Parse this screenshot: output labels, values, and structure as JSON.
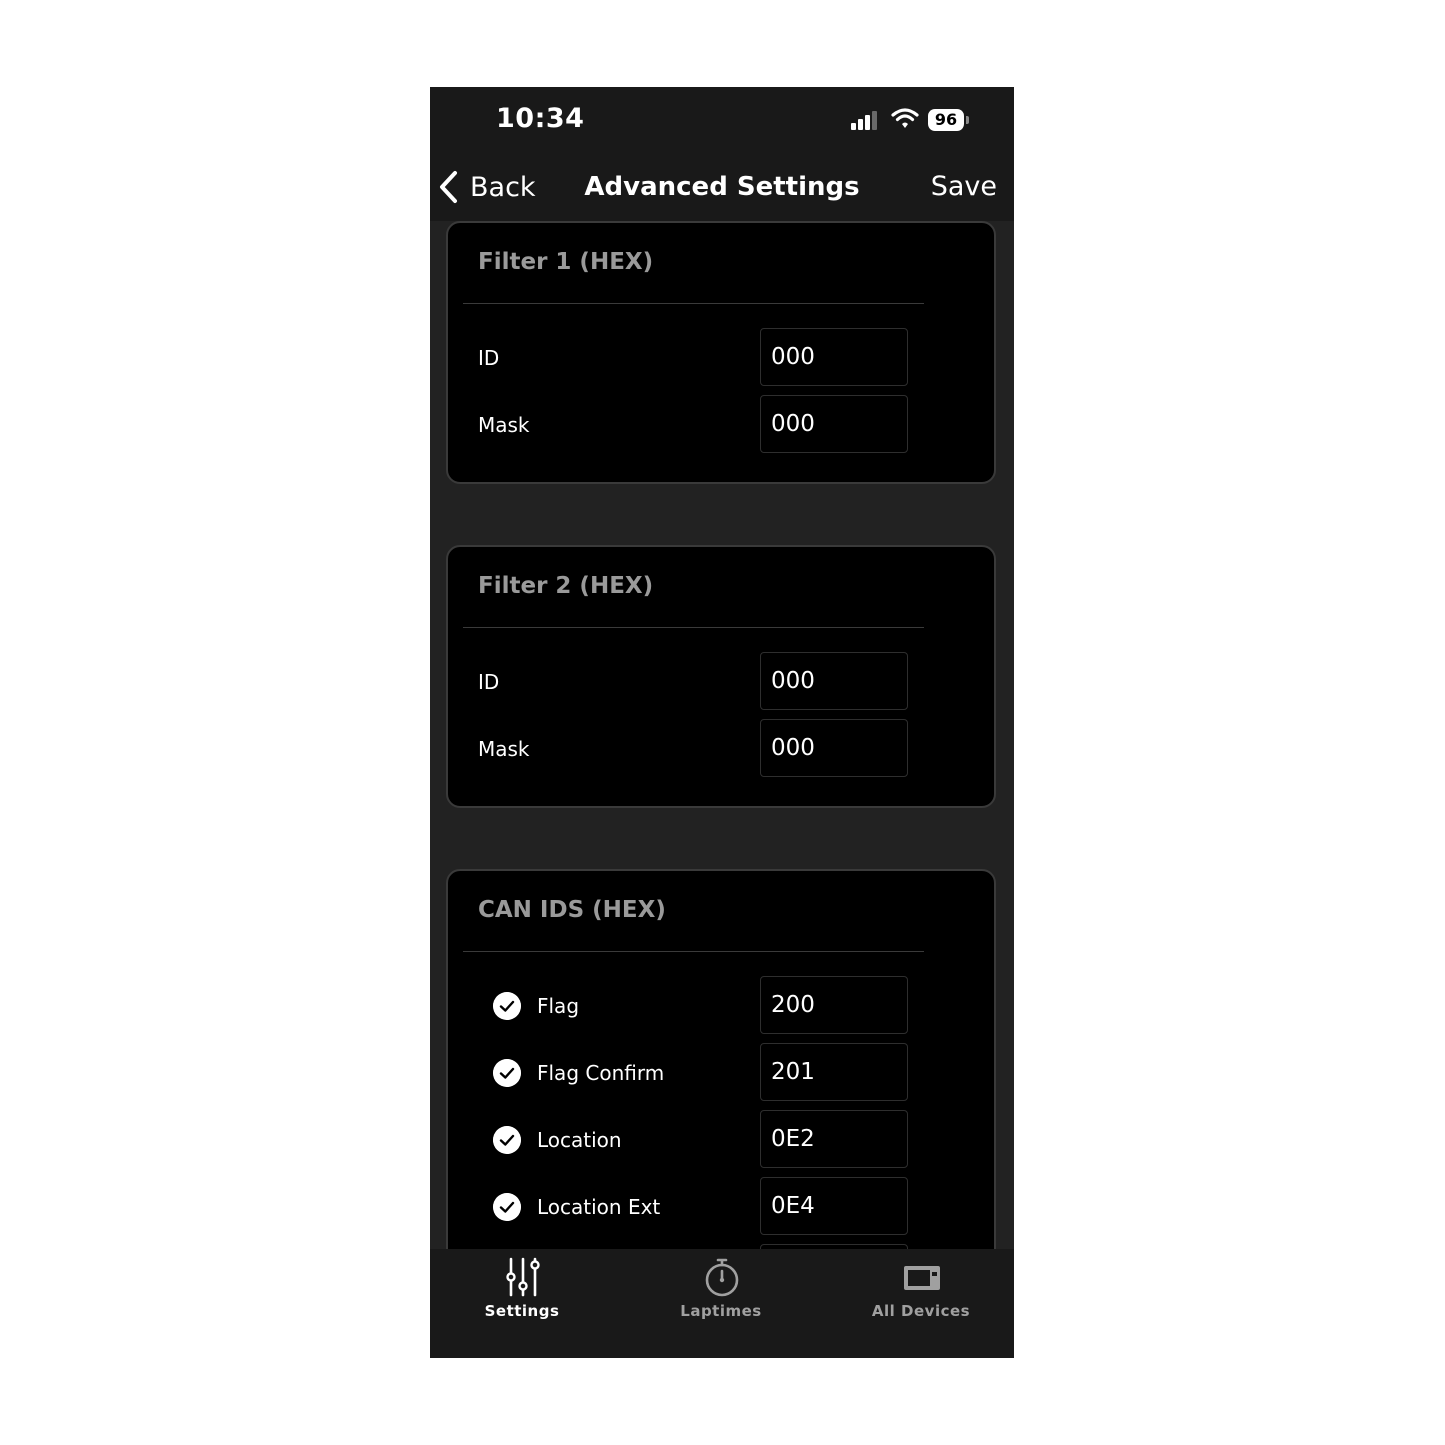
{
  "status_bar": {
    "time": "10:34",
    "battery": "96",
    "signal_icon": "cellular-signal-icon",
    "wifi_icon": "wifi-icon"
  },
  "nav": {
    "back_label": "Back",
    "title": "Advanced Settings",
    "save_label": "Save"
  },
  "filter1": {
    "title": "Filter 1 (HEX)",
    "id_label": "ID",
    "id_value": "000",
    "mask_label": "Mask",
    "mask_value": "000"
  },
  "filter2": {
    "title": "Filter 2 (HEX)",
    "id_label": "ID",
    "id_value": "000",
    "mask_label": "Mask",
    "mask_value": "000"
  },
  "can_ids": {
    "title": "CAN IDS (HEX)",
    "items": [
      {
        "label": "Flag",
        "value": "200",
        "checked": true
      },
      {
        "label": "Flag Confirm",
        "value": "201",
        "checked": true
      },
      {
        "label": "Location",
        "value": "0E2",
        "checked": true
      },
      {
        "label": "Location Ext",
        "value": "0E4",
        "checked": true
      }
    ]
  },
  "tabs": [
    {
      "label": "Settings",
      "icon": "sliders-icon",
      "active": true
    },
    {
      "label": "Laptimes",
      "icon": "stopwatch-icon",
      "active": false
    },
    {
      "label": "All Devices",
      "icon": "device-icon",
      "active": false
    }
  ],
  "colors": {
    "tab_active": "#ffffff",
    "tab_inactive": "#a0a0a0",
    "section_title": "#9a9a9a"
  }
}
